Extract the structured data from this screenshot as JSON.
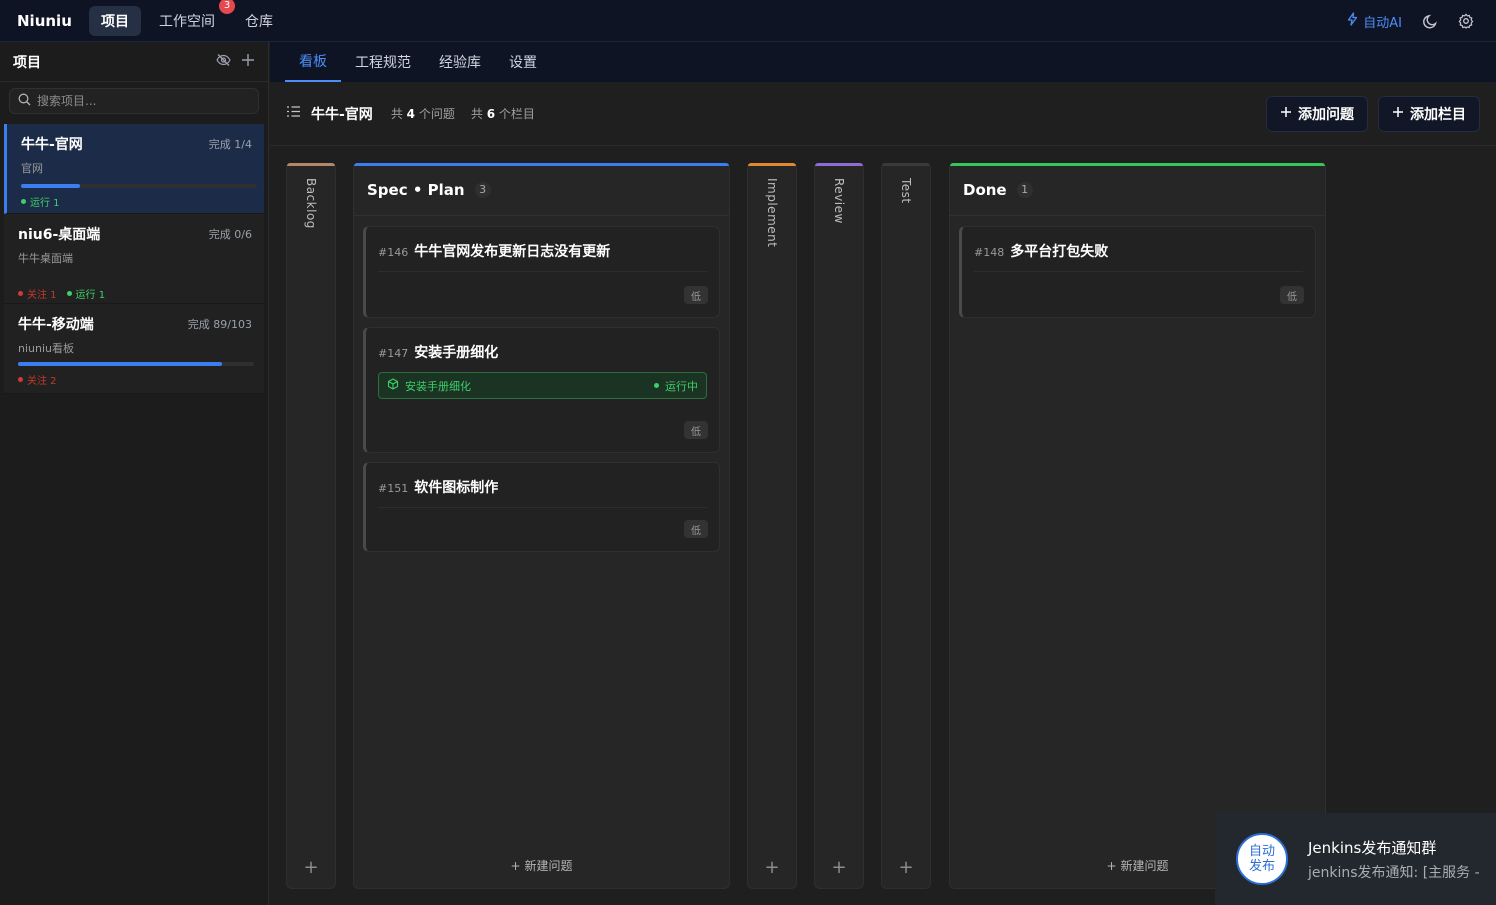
{
  "app": {
    "brand": "Niuniu"
  },
  "topnav": [
    {
      "label": "项目",
      "active": true
    },
    {
      "label": "工作空间",
      "badge": "3"
    },
    {
      "label": "仓库"
    }
  ],
  "top_right": {
    "auto_ai": "自动AI",
    "icons": [
      "lightning-icon",
      "moon-icon",
      "gear-icon"
    ]
  },
  "sidebar": {
    "title": "项目",
    "search_placeholder": "搜索项目...",
    "projects": [
      {
        "name": "牛牛-官网",
        "done": "完成 1/4",
        "sub": "官网",
        "progress": 0.25,
        "tags": [
          {
            "text": "运行 1",
            "color": "green"
          }
        ]
      },
      {
        "name": "niu6-桌面端",
        "done": "完成 0/6",
        "sub": "牛牛桌面端",
        "tags": [
          {
            "text": "关注 1",
            "color": "red"
          },
          {
            "text": "运行 1",
            "color": "green"
          }
        ]
      },
      {
        "name": "牛牛-移动端",
        "done": "完成 89/103",
        "sub": "niuniu看板",
        "progress": 0.864,
        "tags": [
          {
            "text": "关注 2",
            "color": "red"
          }
        ]
      }
    ]
  },
  "tabs": [
    "看板",
    "工程规范",
    "经验库",
    "设置"
  ],
  "board": {
    "name": "牛牛-官网",
    "issues_prefix": "共",
    "issues_count": "4",
    "issues_suffix": "个问题",
    "cols_prefix": "共",
    "cols_count": "6",
    "cols_suffix": "个栏目",
    "add_issue": "添加问题",
    "add_column": "添加栏目",
    "new_issue": "新建问题",
    "columns": {
      "backlog": {
        "label": "Backlog",
        "color": "#b08968"
      },
      "spec": {
        "label": "Spec • Plan",
        "count": "3",
        "color": "#3b7ef0"
      },
      "implement": {
        "label": "Implement",
        "color": "#e08a2e"
      },
      "review": {
        "label": "Review",
        "color": "#8e6cd8"
      },
      "test": {
        "label": "Test",
        "color": "#3a3a3a"
      },
      "done": {
        "label": "Done",
        "count": "1",
        "color": "#35c759"
      }
    },
    "cards": [
      {
        "id": "#146",
        "title": "牛牛官网发布更新日志没有更新",
        "priority": "低"
      },
      {
        "id": "#147",
        "title": "安装手册细化",
        "priority": "低",
        "run": {
          "name": "安装手册细化",
          "status": "运行中"
        }
      },
      {
        "id": "#151",
        "title": "软件图标制作",
        "priority": "低"
      },
      {
        "id": "#148",
        "title": "多平台打包失败",
        "priority": "低"
      }
    ]
  },
  "toast": {
    "logo_line1": "自动",
    "logo_line2": "发布",
    "title": "Jenkins发布通知群",
    "message": "jenkins发布通知: [主服务 -"
  }
}
